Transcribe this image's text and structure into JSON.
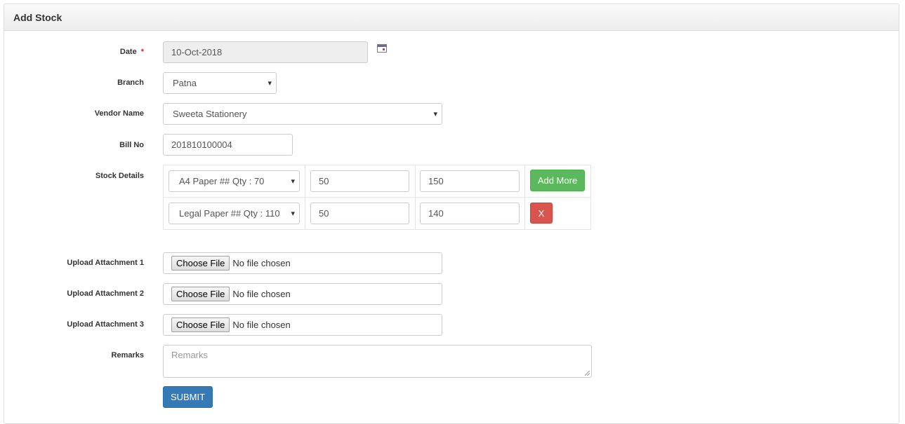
{
  "panel": {
    "title": "Add Stock"
  },
  "form": {
    "date": {
      "label": "Date",
      "required_mark": "*",
      "value": "10-Oct-2018",
      "icon": "calendar-icon"
    },
    "branch": {
      "label": "Branch",
      "value": "Patna"
    },
    "vendor": {
      "label": "Vendor Name",
      "value": "Sweeta Stationery"
    },
    "bill_no": {
      "label": "Bill No",
      "value": "201810100004"
    },
    "stock_details": {
      "label": "Stock Details",
      "rows": [
        {
          "item": "A4 Paper ## Qty : 70",
          "qty": "50",
          "price": "150",
          "action": "Add More"
        },
        {
          "item": "Legal Paper ## Qty : 110",
          "qty": "50",
          "price": "140",
          "action": "X"
        }
      ]
    },
    "attachments": [
      {
        "label": "Upload Attachment 1",
        "button": "Choose File",
        "status": "No file chosen"
      },
      {
        "label": "Upload Attachment 2",
        "button": "Choose File",
        "status": "No file chosen"
      },
      {
        "label": "Upload Attachment 3",
        "button": "Choose File",
        "status": "No file chosen"
      }
    ],
    "remarks": {
      "label": "Remarks",
      "placeholder": "Remarks"
    },
    "submit_label": "SUBMIT"
  },
  "colors": {
    "success": "#5cb85c",
    "danger": "#d9534f",
    "primary": "#337ab7",
    "required": "#e02020"
  }
}
